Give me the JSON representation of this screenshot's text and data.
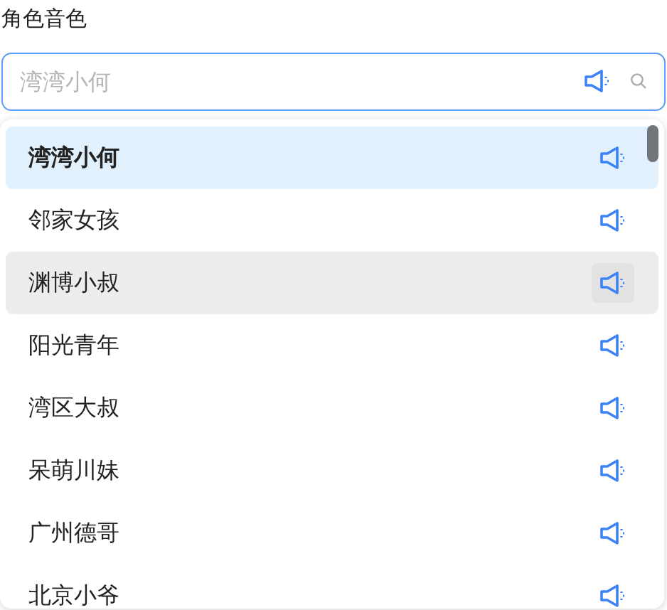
{
  "label": "角色音色",
  "search": {
    "placeholder": "湾湾小何"
  },
  "options": [
    {
      "name": "湾湾小何",
      "selected": true,
      "hovered": false
    },
    {
      "name": "邻家女孩",
      "selected": false,
      "hovered": false
    },
    {
      "name": "渊博小叔",
      "selected": false,
      "hovered": true
    },
    {
      "name": "阳光青年",
      "selected": false,
      "hovered": false
    },
    {
      "name": "湾区大叔",
      "selected": false,
      "hovered": false
    },
    {
      "name": "呆萌川妹",
      "selected": false,
      "hovered": false
    },
    {
      "name": "广州德哥",
      "selected": false,
      "hovered": false
    },
    {
      "name": "北京小爷",
      "selected": false,
      "hovered": false
    }
  ]
}
